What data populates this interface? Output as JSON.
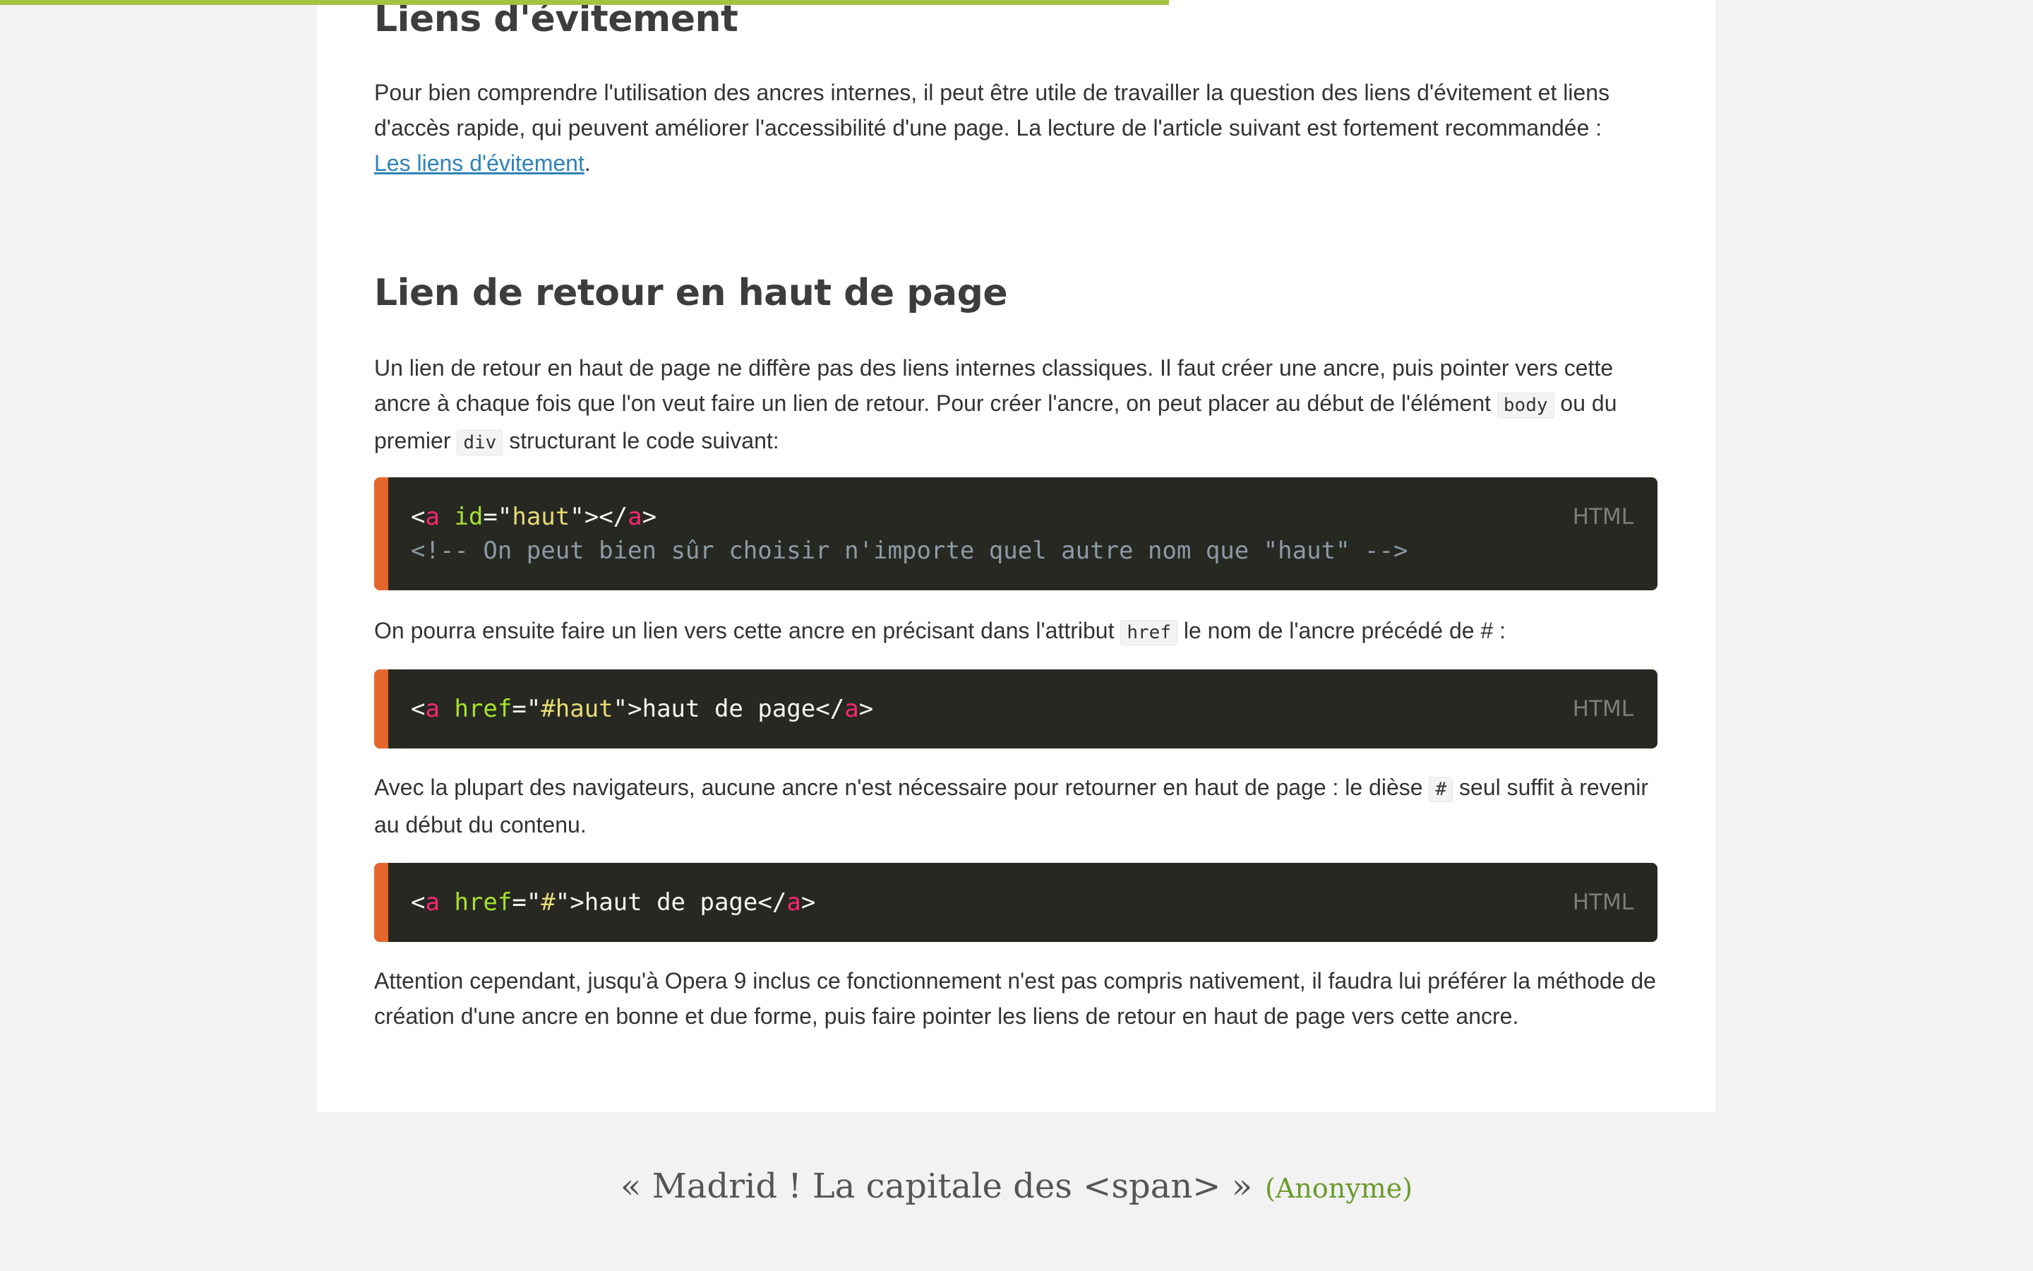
{
  "progress": {
    "percent": 57.5,
    "color": "#a7c143"
  },
  "section1": {
    "title": "Liens d'évitement",
    "text": "Pour bien comprendre l'utilisation des ancres internes, il peut être utile de travailler la question des liens d'évitement et liens d'accès rapide, qui peuvent améliorer l'accessibilité d'une page. La lecture de l'article suivant est fortement recommandée :",
    "link": "Les liens d'évitement",
    "after_link": "."
  },
  "section2": {
    "title": "Lien de retour en haut de page",
    "p1_before": "Un lien de retour en haut de page ne diffère pas des liens internes classiques. Il faut créer une ancre, puis pointer vers cette ancre à chaque fois que l'on veut faire un lien de retour. Pour créer l'ancre, on peut placer au début de l'élément",
    "p1_code1": "body",
    "p1_middle": "ou du premier",
    "p1_code2": "div",
    "p1_after": "structurant le code suivant:",
    "p2_before": "On pourra ensuite faire un lien vers cette ancre en précisant dans l'attribut",
    "p2_code": "href",
    "p2_after": "le nom de l'ancre précédé de # :",
    "p3_before": "Avec la plupart des navigateurs, aucune ancre n'est nécessaire pour retourner en haut de page : le dièse",
    "p3_code": "#",
    "p3_after": "seul suffit à revenir au début du contenu.",
    "p4": "Attention cependant, jusqu'à Opera 9 inclus ce fonctionnement n'est pas compris nativement, il faudra lui préférer la méthode de création d'une ancre en bonne et due forme, puis faire pointer les liens de retour en haut de page vers cette ancre."
  },
  "code_blocks": [
    {
      "language": "HTML",
      "lines": [
        [
          {
            "t": "punct",
            "v": "<"
          },
          {
            "t": "tag",
            "v": "a"
          },
          {
            "t": "text",
            "v": " "
          },
          {
            "t": "attr",
            "v": "id"
          },
          {
            "t": "punct",
            "v": "=\""
          },
          {
            "t": "str",
            "v": "haut"
          },
          {
            "t": "punct",
            "v": "\"></"
          },
          {
            "t": "tag",
            "v": "a"
          },
          {
            "t": "punct",
            "v": ">"
          }
        ],
        [
          {
            "t": "comment",
            "v": "<!-- On peut bien sûr choisir n'importe quel autre nom que \"haut\" -->"
          }
        ]
      ]
    },
    {
      "language": "HTML",
      "lines": [
        [
          {
            "t": "punct",
            "v": "<"
          },
          {
            "t": "tag",
            "v": "a"
          },
          {
            "t": "text",
            "v": " "
          },
          {
            "t": "attr",
            "v": "href"
          },
          {
            "t": "punct",
            "v": "=\""
          },
          {
            "t": "str",
            "v": "#haut"
          },
          {
            "t": "punct",
            "v": "\">"
          },
          {
            "t": "text",
            "v": "haut de page"
          },
          {
            "t": "punct",
            "v": "</"
          },
          {
            "t": "tag",
            "v": "a"
          },
          {
            "t": "punct",
            "v": ">"
          }
        ]
      ]
    },
    {
      "language": "HTML",
      "lines": [
        [
          {
            "t": "punct",
            "v": "<"
          },
          {
            "t": "tag",
            "v": "a"
          },
          {
            "t": "text",
            "v": " "
          },
          {
            "t": "attr",
            "v": "href"
          },
          {
            "t": "punct",
            "v": "=\""
          },
          {
            "t": "str",
            "v": "#"
          },
          {
            "t": "punct",
            "v": "\">"
          },
          {
            "t": "text",
            "v": "haut de page"
          },
          {
            "t": "punct",
            "v": "</"
          },
          {
            "t": "tag",
            "v": "a"
          },
          {
            "t": "punct",
            "v": ">"
          }
        ]
      ]
    }
  ],
  "footer": {
    "quote": "« Madrid ! La capitale des <span> »",
    "author": "(Anonyme)"
  }
}
